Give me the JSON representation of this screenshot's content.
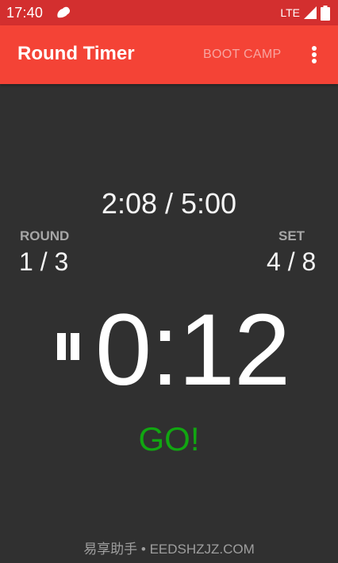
{
  "status_bar": {
    "time": "17:40",
    "network": "LTE",
    "icons": [
      "app-notification-icon",
      "signal-icon",
      "battery-icon"
    ]
  },
  "app_bar": {
    "title": "Round Timer",
    "preset_button": "BOOT CAMP",
    "menu_icon": "overflow-menu-icon"
  },
  "timer": {
    "total_time": "2:08 / 5:00",
    "round_label": "ROUND",
    "round_value": "1 / 3",
    "set_label": "SET",
    "set_value": "4 / 8",
    "countdown": "0:12",
    "phase": "GO!",
    "pause_icon": "pause-icon"
  },
  "watermark": "易享助手 • EEDSHZJZ.COM",
  "colors": {
    "status_bar": "#d32f2f",
    "app_bar": "#f44336",
    "background": "#303030",
    "phase_text": "#11a611",
    "preset_text": "#f8a5a0"
  }
}
